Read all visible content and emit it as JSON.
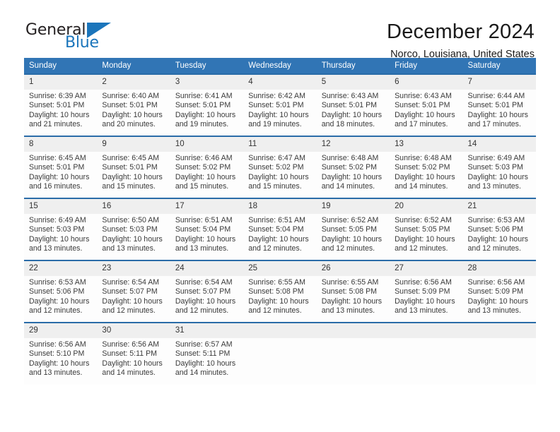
{
  "brand": {
    "name_part1": "General",
    "name_part2": "Blue",
    "accent_color": "#1b75bb"
  },
  "header": {
    "title": "December 2024",
    "location": "Norco, Louisiana, United States"
  },
  "theme": {
    "header_blue": "#3175b5",
    "row_divider": "#2a6ca8",
    "daynum_band": "#efefef"
  },
  "calendar": {
    "weekday_headers": [
      "Sunday",
      "Monday",
      "Tuesday",
      "Wednesday",
      "Thursday",
      "Friday",
      "Saturday"
    ],
    "weeks": [
      [
        {
          "day": "1",
          "sunrise": "Sunrise: 6:39 AM",
          "sunset": "Sunset: 5:01 PM",
          "daylight1": "Daylight: 10 hours",
          "daylight2": "and 21 minutes."
        },
        {
          "day": "2",
          "sunrise": "Sunrise: 6:40 AM",
          "sunset": "Sunset: 5:01 PM",
          "daylight1": "Daylight: 10 hours",
          "daylight2": "and 20 minutes."
        },
        {
          "day": "3",
          "sunrise": "Sunrise: 6:41 AM",
          "sunset": "Sunset: 5:01 PM",
          "daylight1": "Daylight: 10 hours",
          "daylight2": "and 19 minutes."
        },
        {
          "day": "4",
          "sunrise": "Sunrise: 6:42 AM",
          "sunset": "Sunset: 5:01 PM",
          "daylight1": "Daylight: 10 hours",
          "daylight2": "and 19 minutes."
        },
        {
          "day": "5",
          "sunrise": "Sunrise: 6:43 AM",
          "sunset": "Sunset: 5:01 PM",
          "daylight1": "Daylight: 10 hours",
          "daylight2": "and 18 minutes."
        },
        {
          "day": "6",
          "sunrise": "Sunrise: 6:43 AM",
          "sunset": "Sunset: 5:01 PM",
          "daylight1": "Daylight: 10 hours",
          "daylight2": "and 17 minutes."
        },
        {
          "day": "7",
          "sunrise": "Sunrise: 6:44 AM",
          "sunset": "Sunset: 5:01 PM",
          "daylight1": "Daylight: 10 hours",
          "daylight2": "and 17 minutes."
        }
      ],
      [
        {
          "day": "8",
          "sunrise": "Sunrise: 6:45 AM",
          "sunset": "Sunset: 5:01 PM",
          "daylight1": "Daylight: 10 hours",
          "daylight2": "and 16 minutes."
        },
        {
          "day": "9",
          "sunrise": "Sunrise: 6:45 AM",
          "sunset": "Sunset: 5:01 PM",
          "daylight1": "Daylight: 10 hours",
          "daylight2": "and 15 minutes."
        },
        {
          "day": "10",
          "sunrise": "Sunrise: 6:46 AM",
          "sunset": "Sunset: 5:02 PM",
          "daylight1": "Daylight: 10 hours",
          "daylight2": "and 15 minutes."
        },
        {
          "day": "11",
          "sunrise": "Sunrise: 6:47 AM",
          "sunset": "Sunset: 5:02 PM",
          "daylight1": "Daylight: 10 hours",
          "daylight2": "and 15 minutes."
        },
        {
          "day": "12",
          "sunrise": "Sunrise: 6:48 AM",
          "sunset": "Sunset: 5:02 PM",
          "daylight1": "Daylight: 10 hours",
          "daylight2": "and 14 minutes."
        },
        {
          "day": "13",
          "sunrise": "Sunrise: 6:48 AM",
          "sunset": "Sunset: 5:02 PM",
          "daylight1": "Daylight: 10 hours",
          "daylight2": "and 14 minutes."
        },
        {
          "day": "14",
          "sunrise": "Sunrise: 6:49 AM",
          "sunset": "Sunset: 5:03 PM",
          "daylight1": "Daylight: 10 hours",
          "daylight2": "and 13 minutes."
        }
      ],
      [
        {
          "day": "15",
          "sunrise": "Sunrise: 6:49 AM",
          "sunset": "Sunset: 5:03 PM",
          "daylight1": "Daylight: 10 hours",
          "daylight2": "and 13 minutes."
        },
        {
          "day": "16",
          "sunrise": "Sunrise: 6:50 AM",
          "sunset": "Sunset: 5:03 PM",
          "daylight1": "Daylight: 10 hours",
          "daylight2": "and 13 minutes."
        },
        {
          "day": "17",
          "sunrise": "Sunrise: 6:51 AM",
          "sunset": "Sunset: 5:04 PM",
          "daylight1": "Daylight: 10 hours",
          "daylight2": "and 13 minutes."
        },
        {
          "day": "18",
          "sunrise": "Sunrise: 6:51 AM",
          "sunset": "Sunset: 5:04 PM",
          "daylight1": "Daylight: 10 hours",
          "daylight2": "and 12 minutes."
        },
        {
          "day": "19",
          "sunrise": "Sunrise: 6:52 AM",
          "sunset": "Sunset: 5:05 PM",
          "daylight1": "Daylight: 10 hours",
          "daylight2": "and 12 minutes."
        },
        {
          "day": "20",
          "sunrise": "Sunrise: 6:52 AM",
          "sunset": "Sunset: 5:05 PM",
          "daylight1": "Daylight: 10 hours",
          "daylight2": "and 12 minutes."
        },
        {
          "day": "21",
          "sunrise": "Sunrise: 6:53 AM",
          "sunset": "Sunset: 5:06 PM",
          "daylight1": "Daylight: 10 hours",
          "daylight2": "and 12 minutes."
        }
      ],
      [
        {
          "day": "22",
          "sunrise": "Sunrise: 6:53 AM",
          "sunset": "Sunset: 5:06 PM",
          "daylight1": "Daylight: 10 hours",
          "daylight2": "and 12 minutes."
        },
        {
          "day": "23",
          "sunrise": "Sunrise: 6:54 AM",
          "sunset": "Sunset: 5:07 PM",
          "daylight1": "Daylight: 10 hours",
          "daylight2": "and 12 minutes."
        },
        {
          "day": "24",
          "sunrise": "Sunrise: 6:54 AM",
          "sunset": "Sunset: 5:07 PM",
          "daylight1": "Daylight: 10 hours",
          "daylight2": "and 12 minutes."
        },
        {
          "day": "25",
          "sunrise": "Sunrise: 6:55 AM",
          "sunset": "Sunset: 5:08 PM",
          "daylight1": "Daylight: 10 hours",
          "daylight2": "and 12 minutes."
        },
        {
          "day": "26",
          "sunrise": "Sunrise: 6:55 AM",
          "sunset": "Sunset: 5:08 PM",
          "daylight1": "Daylight: 10 hours",
          "daylight2": "and 13 minutes."
        },
        {
          "day": "27",
          "sunrise": "Sunrise: 6:56 AM",
          "sunset": "Sunset: 5:09 PM",
          "daylight1": "Daylight: 10 hours",
          "daylight2": "and 13 minutes."
        },
        {
          "day": "28",
          "sunrise": "Sunrise: 6:56 AM",
          "sunset": "Sunset: 5:09 PM",
          "daylight1": "Daylight: 10 hours",
          "daylight2": "and 13 minutes."
        }
      ],
      [
        {
          "day": "29",
          "sunrise": "Sunrise: 6:56 AM",
          "sunset": "Sunset: 5:10 PM",
          "daylight1": "Daylight: 10 hours",
          "daylight2": "and 13 minutes."
        },
        {
          "day": "30",
          "sunrise": "Sunrise: 6:56 AM",
          "sunset": "Sunset: 5:11 PM",
          "daylight1": "Daylight: 10 hours",
          "daylight2": "and 14 minutes."
        },
        {
          "day": "31",
          "sunrise": "Sunrise: 6:57 AM",
          "sunset": "Sunset: 5:11 PM",
          "daylight1": "Daylight: 10 hours",
          "daylight2": "and 14 minutes."
        },
        {
          "day": "",
          "sunrise": "",
          "sunset": "",
          "daylight1": "",
          "daylight2": ""
        },
        {
          "day": "",
          "sunrise": "",
          "sunset": "",
          "daylight1": "",
          "daylight2": ""
        },
        {
          "day": "",
          "sunrise": "",
          "sunset": "",
          "daylight1": "",
          "daylight2": ""
        },
        {
          "day": "",
          "sunrise": "",
          "sunset": "",
          "daylight1": "",
          "daylight2": ""
        }
      ]
    ]
  }
}
